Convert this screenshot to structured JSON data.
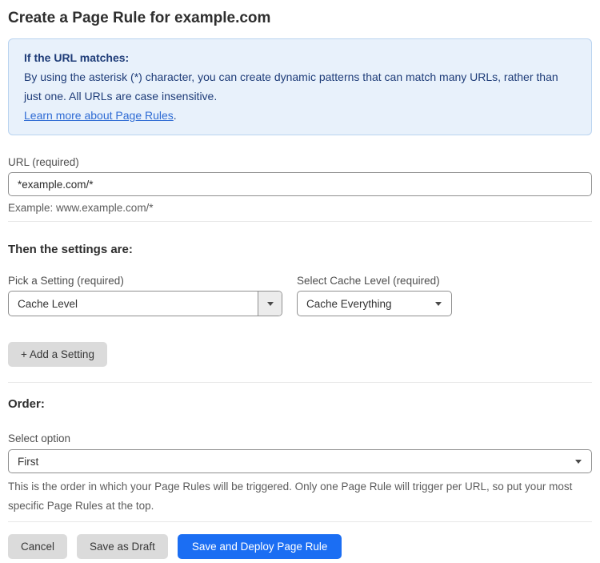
{
  "page": {
    "title": "Create a Page Rule for example.com"
  },
  "info_box": {
    "heading": "If the URL matches:",
    "body": "By using the asterisk (*) character, you can create dynamic patterns that can match many URLs, rather than just one. All URLs are case insensitive.",
    "link_label": "Learn more about Page Rules",
    "link_suffix": "."
  },
  "url_field": {
    "label": "URL (required)",
    "value": "*example.com/*",
    "hint": "Example: www.example.com/*"
  },
  "settings_section": {
    "heading": "Then the settings are:",
    "setting_picker": {
      "label": "Pick a Setting (required)",
      "selected": "Cache Level"
    },
    "cache_level_picker": {
      "label": "Select Cache Level (required)",
      "selected": "Cache Everything"
    },
    "add_setting_label": "+ Add a Setting"
  },
  "order_section": {
    "heading": "Order:",
    "select_label": "Select option",
    "selected": "First",
    "description": "This is the order in which your Page Rules will be triggered. Only one Page Rule will trigger per URL, so put your most specific Page Rules at the top."
  },
  "actions": {
    "cancel_label": "Cancel",
    "save_draft_label": "Save as Draft",
    "save_deploy_label": "Save and Deploy Page Rule"
  },
  "colors": {
    "primary_blue": "#1b6ef3",
    "info_bg": "#e8f1fb",
    "info_border": "#b9d3f0",
    "info_text": "#1e3c78",
    "link_blue": "#2e6bd4"
  }
}
